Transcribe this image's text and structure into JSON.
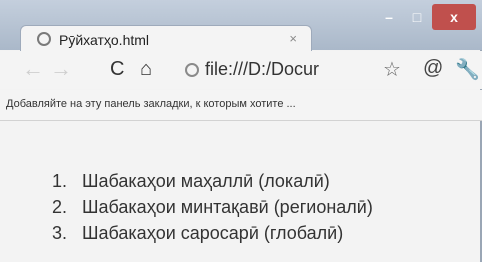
{
  "tab": {
    "title": "Рӯйхатҳо.html",
    "close": "×"
  },
  "window_controls": {
    "minimize": "–",
    "maximize": "□",
    "close": "x"
  },
  "toolbar": {
    "back": "←",
    "forward": "→",
    "reload": "C",
    "home": "⌂",
    "url": "file:///D:/Docur",
    "star": "☆",
    "extension": "@",
    "wrench": "🔧"
  },
  "bookmarks_bar": {
    "text": "Добавляйте на эту панель закладки, к которым хотите ..."
  },
  "list": [
    {
      "number": "1.",
      "text": "Шабакаҳои маҳаллӣ (локалӣ)"
    },
    {
      "number": "2.",
      "text": "Шабакаҳои минтақавӣ (регионалӣ)"
    },
    {
      "number": "3.",
      "text": "Шабакаҳои саросарӣ (глобалӣ)"
    }
  ]
}
